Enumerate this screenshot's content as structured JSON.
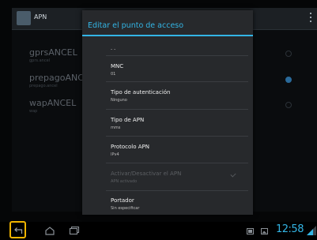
{
  "background": {
    "title": "APN",
    "items": [
      {
        "name": "gprsANCEL",
        "sub": "gprs.ancel",
        "selected": false
      },
      {
        "name": "prepagoANCE",
        "sub": "prepago.ancel",
        "selected": true
      },
      {
        "name": "wapANCEL",
        "sub": "wap",
        "selected": false
      }
    ]
  },
  "dialog": {
    "title": "Editar el punto de acceso",
    "partial_value": "- -",
    "rows": [
      {
        "label": "MNC",
        "value": "01",
        "disabled": false
      },
      {
        "label": "Tipo de autenticación",
        "value": "Ninguno",
        "disabled": false
      },
      {
        "label": "Tipo de APN",
        "value": "mms",
        "disabled": false
      },
      {
        "label": "Protocolo APN",
        "value": "IPv4",
        "disabled": false
      },
      {
        "label": "Activar/Desactivar el APN",
        "value": "APN activado",
        "disabled": true
      },
      {
        "label": "Portador",
        "value": "Sin especificar",
        "disabled": false
      }
    ]
  },
  "navbar": {
    "time": "12:58"
  },
  "colors": {
    "accent": "#33b5e5",
    "highlight": "#f0b400"
  },
  "icons": [
    "app-icon",
    "overflow-menu-icon",
    "back-icon",
    "home-icon",
    "recent-apps-icon",
    "screenshot-notification-icon",
    "gallery-notification-icon",
    "signal-icon"
  ]
}
